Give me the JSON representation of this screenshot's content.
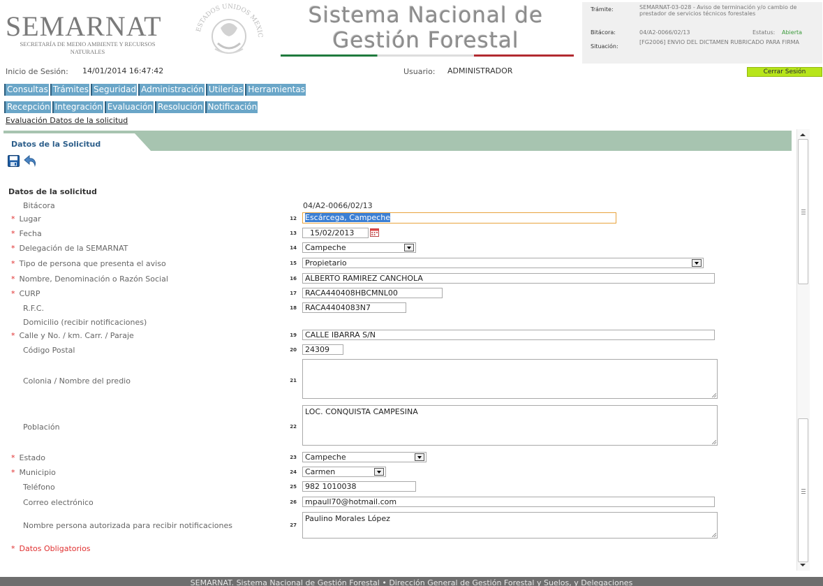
{
  "header": {
    "brand": "SEMARNAT",
    "brand_subtitle": "SECRETARÍA DE MEDIO AMBIENTE Y RECURSOS NATURALES",
    "seal_text": "ESTADOS UNIDOS MEXICANOS",
    "system_title_line1": "Sistema Nacional de",
    "system_title_line2": "Gestión Forestal",
    "tramite_label": "Trámite:",
    "tramite_value": "SEMARNAT-03-028 - Aviso de terminación y/o cambio de prestador de servicios técnicos forestales",
    "bitacora_label": "Bitácora:",
    "bitacora_value": "04/A2-0066/02/13",
    "estatus_label": "Estatus:",
    "estatus_value": "Abierta",
    "situacion_label": "Situación:",
    "situacion_value": "[FG2006] ENVIO DEL DICTAMEN RUBRICADO PARA FIRMA"
  },
  "session": {
    "start_label": "Inicio de Sesión:",
    "start_value": "14/01/2014 16:47:42",
    "user_label": "Usuario:",
    "user_value": "ADMINISTRADOR",
    "logout_label": "Cerrar Sesión"
  },
  "menu_main": [
    "Consultas",
    "Trámites",
    "Seguridad",
    "Administración",
    "Utilerías",
    "Herramientas"
  ],
  "menu_process": [
    "Recepción",
    "Integración",
    "Evaluación",
    "Resolución",
    "Notificación"
  ],
  "breadcrumb": "Evaluación Datos de la solicitud",
  "panel": {
    "tab_label": "Datos de la Solicitud",
    "section_title": "Datos de la solicitud"
  },
  "form": {
    "bitacora": {
      "label": "Bitácora",
      "value": "04/A2-0066/02/13"
    },
    "lugar": {
      "label": "Lugar",
      "num": "12",
      "value": "Escárcega, Campeche"
    },
    "fecha": {
      "label": "Fecha",
      "num": "13",
      "value": "15/02/2013"
    },
    "delegacion": {
      "label": "Delegación de la SEMARNAT",
      "num": "14",
      "value": "Campeche"
    },
    "tipo_persona": {
      "label": "Tipo de persona que presenta el aviso",
      "num": "15",
      "value": "Propietario"
    },
    "nombre": {
      "label": "Nombre, Denominación o Razón Social",
      "num": "16",
      "value": "ALBERTO RAMIREZ CANCHOLA"
    },
    "curp": {
      "label": "CURP",
      "num": "17",
      "value": "RACA440408HBCMNL00"
    },
    "rfc": {
      "label": "R.F.C.",
      "num": "18",
      "value": "RACA4404083N7"
    },
    "domicilio": {
      "label": "Domicilio (recibir notificaciones)"
    },
    "calle": {
      "label": "Calle y No. / km. Carr. / Paraje",
      "num": "19",
      "value": "CALLE IBARRA S/N"
    },
    "cp": {
      "label": "Código Postal",
      "num": "20",
      "value": "24309"
    },
    "colonia": {
      "label": "Colonia / Nombre del predio",
      "num": "21",
      "value": ""
    },
    "poblacion": {
      "label": "Población",
      "num": "22",
      "value": "LOC. CONQUISTA CAMPESINA"
    },
    "estado": {
      "label": "Estado",
      "num": "23",
      "value": "Campeche"
    },
    "municipio": {
      "label": "Municipio",
      "num": "24",
      "value": "Carmen"
    },
    "telefono": {
      "label": "Teléfono",
      "num": "25",
      "value": "982 1010038"
    },
    "correo": {
      "label": "Correo electrónico",
      "num": "26",
      "value": "mpaull70@hotmail.com"
    },
    "autorizada": {
      "label": "Nombre persona autorizada para recibir notificaciones",
      "num": "27",
      "value": "Paulino Morales López"
    },
    "required_mark": "*",
    "required_note": "Datos Obligatorios"
  },
  "footer": "SEMARNAT. Sistema Nacional de Gestión Forestal • Dirección General de Gestión Forestal y Suelos, y Delegaciones",
  "colors": {
    "menu": "#6aa6c8",
    "tab_strip": "#a7c4b0",
    "logout": "#b7e51a",
    "required": "#e03030",
    "status_open": "#3a9a3a"
  },
  "icons": [
    "save-icon",
    "undo-icon",
    "calendar-icon",
    "dropdown-arrow-icon"
  ]
}
